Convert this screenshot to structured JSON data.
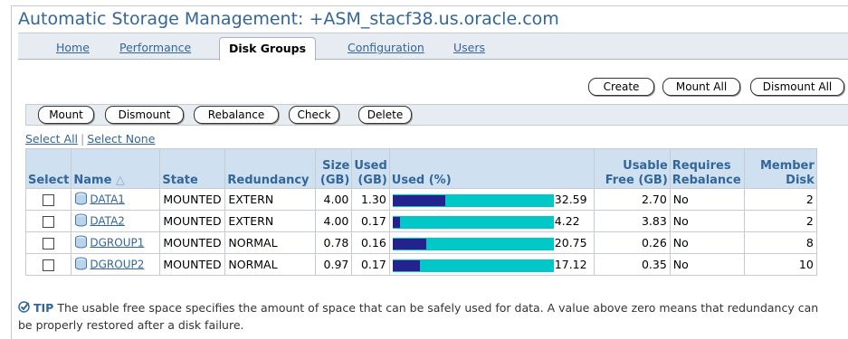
{
  "page": {
    "title": "Automatic Storage Management: +ASM_stacf38.us.oracle.com"
  },
  "tabs": [
    {
      "label": "Home",
      "active": false
    },
    {
      "label": "Performance",
      "active": false
    },
    {
      "label": "Disk Groups",
      "active": true
    },
    {
      "label": "Configuration",
      "active": false
    },
    {
      "label": "Users",
      "active": false
    }
  ],
  "top_buttons": {
    "create": "Create",
    "mount_all": "Mount All",
    "dismount_all": "Dismount All"
  },
  "action_buttons": {
    "mount": "Mount",
    "dismount": "Dismount",
    "rebalance": "Rebalance",
    "check": "Check",
    "delete": "Delete"
  },
  "select_links": {
    "select_all": "Select All",
    "select_none": "Select None"
  },
  "table": {
    "headers": {
      "select": "Select",
      "name": "Name",
      "name_sort_glyph": "△",
      "state": "State",
      "redundancy": "Redundancy",
      "size_1": "Size",
      "size_2": "(GB)",
      "used_1": "Used",
      "used_2": "(GB)",
      "used_pct": "Used (%)",
      "usable_1": "Usable",
      "usable_2": "Free (GB)",
      "requires_1": "Requires",
      "requires_2": "Rebalance",
      "member_1": "Member",
      "member_2": "Disk"
    },
    "rows": [
      {
        "name": "DATA1",
        "state": "MOUNTED",
        "redundancy": "EXTERN",
        "size": "4.00",
        "used": "1.30",
        "used_pct": "32.59",
        "usable_free": "2.70",
        "requires_rebalance": "No",
        "member_disk": "2"
      },
      {
        "name": "DATA2",
        "state": "MOUNTED",
        "redundancy": "EXTERN",
        "size": "4.00",
        "used": "0.17",
        "used_pct": "4.22",
        "usable_free": "3.83",
        "requires_rebalance": "No",
        "member_disk": "2"
      },
      {
        "name": "DGROUP1",
        "state": "MOUNTED",
        "redundancy": "NORMAL",
        "size": "0.78",
        "used": "0.16",
        "used_pct": "20.75",
        "usable_free": "0.26",
        "requires_rebalance": "No",
        "member_disk": "8"
      },
      {
        "name": "DGROUP2",
        "state": "MOUNTED",
        "redundancy": "NORMAL",
        "size": "0.97",
        "used": "0.17",
        "used_pct": "17.12",
        "usable_free": "0.35",
        "requires_rebalance": "No",
        "member_disk": "10"
      }
    ]
  },
  "tip": {
    "label": "TIP",
    "text": "The usable free space specifies the amount of space that can be safely used for data. A value above zero means that redundancy can be properly restored after a disk failure."
  },
  "colors": {
    "link": "#336699",
    "bar_used": "#23238e",
    "bar_free": "#00c8c8",
    "header_bg": "#cfe0f1"
  }
}
